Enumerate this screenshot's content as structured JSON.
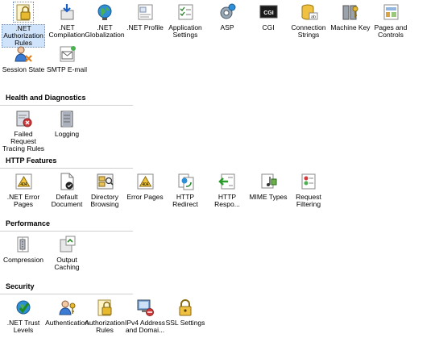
{
  "top_features": [
    {
      "label": ".NET Authorization Rules",
      "icon": "authorization-rules-icon"
    },
    {
      "label": ".NET Compilation",
      "icon": "compilation-icon"
    },
    {
      "label": ".NET Globalization",
      "icon": "globe-icon"
    },
    {
      "label": ".NET Profile",
      "icon": "profile-icon"
    },
    {
      "label": "Application Settings",
      "icon": "settings-icon"
    },
    {
      "label": "ASP",
      "icon": "asp-icon"
    },
    {
      "label": "CGI",
      "icon": "cgi-icon"
    },
    {
      "label": "Connection Strings",
      "icon": "database-icon"
    },
    {
      "label": "Machine Key",
      "icon": "machine-key-icon"
    },
    {
      "label": "Pages and Controls",
      "icon": "pages-controls-icon"
    },
    {
      "label": "Session State",
      "icon": "session-state-icon"
    },
    {
      "label": "SMTP E-mail",
      "icon": "smtp-email-icon"
    }
  ],
  "sections": [
    {
      "title": "Health and Diagnostics",
      "items": [
        {
          "label": "Failed Request Tracing Rules",
          "icon": "failed-request-icon"
        },
        {
          "label": "Logging",
          "icon": "logging-icon"
        }
      ]
    },
    {
      "title": "HTTP Features",
      "items": [
        {
          "label": ".NET Error Pages",
          "icon": "error-page-icon"
        },
        {
          "label": "Default Document",
          "icon": "default-document-icon"
        },
        {
          "label": "Directory Browsing",
          "icon": "directory-browsing-icon"
        },
        {
          "label": "Error Pages",
          "icon": "error-page-icon"
        },
        {
          "label": "HTTP Redirect",
          "icon": "http-redirect-icon"
        },
        {
          "label": "HTTP Respo...",
          "icon": "http-response-headers-icon"
        },
        {
          "label": "MIME Types",
          "icon": "mime-types-icon"
        },
        {
          "label": "Request Filtering",
          "icon": "request-filtering-icon"
        }
      ]
    },
    {
      "title": "Performance",
      "items": [
        {
          "label": "Compression",
          "icon": "compression-icon"
        },
        {
          "label": "Output Caching",
          "icon": "output-caching-icon"
        }
      ]
    },
    {
      "title": "Security",
      "items": [
        {
          "label": ".NET Trust Levels",
          "icon": "trust-levels-icon"
        },
        {
          "label": "Authentication",
          "icon": "authentication-icon"
        },
        {
          "label": "Authorization Rules",
          "icon": "authorization-rules-icon"
        },
        {
          "label": "IPv4 Address and Domai...",
          "icon": "ipv4-icon"
        },
        {
          "label": "SSL Settings",
          "icon": "lock-icon"
        }
      ]
    }
  ],
  "selected_label": ".NET Authorization Rules"
}
